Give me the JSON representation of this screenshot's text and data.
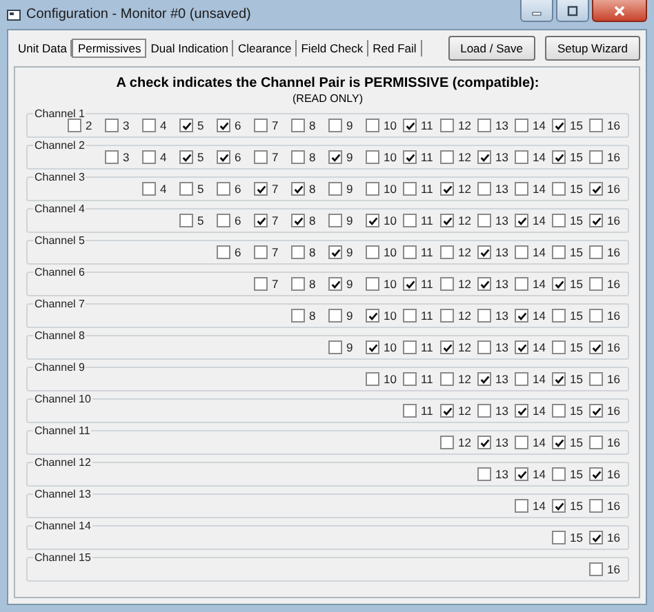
{
  "window": {
    "title": "Configuration - Monitor #0 (unsaved)"
  },
  "tabs": [
    {
      "label": "Unit Data",
      "selected": false
    },
    {
      "label": "Permissives",
      "selected": true
    },
    {
      "label": "Dual Indication",
      "selected": false
    },
    {
      "label": "Clearance",
      "selected": false
    },
    {
      "label": "Field Check",
      "selected": false
    },
    {
      "label": "Red Fail",
      "selected": false
    }
  ],
  "buttons": [
    "Load / Save",
    "Setup Wizard"
  ],
  "heading": "A check indicates the Channel Pair is PERMISSIVE (compatible):",
  "subheading": "(READ ONLY)",
  "channels": [
    {
      "name": "Channel 1",
      "pairs": [
        {
          "label": "2",
          "checked": false
        },
        {
          "label": "3",
          "checked": false
        },
        {
          "label": "4",
          "checked": false
        },
        {
          "label": "5",
          "checked": true
        },
        {
          "label": "6",
          "checked": true
        },
        {
          "label": "7",
          "checked": false
        },
        {
          "label": "8",
          "checked": false
        },
        {
          "label": "9",
          "checked": false
        },
        {
          "label": "10",
          "checked": false
        },
        {
          "label": "11",
          "checked": true
        },
        {
          "label": "12",
          "checked": false
        },
        {
          "label": "13",
          "checked": false
        },
        {
          "label": "14",
          "checked": false
        },
        {
          "label": "15",
          "checked": true
        },
        {
          "label": "16",
          "checked": false
        }
      ]
    },
    {
      "name": "Channel 2",
      "pairs": [
        {
          "label": "3",
          "checked": false
        },
        {
          "label": "4",
          "checked": false
        },
        {
          "label": "5",
          "checked": true
        },
        {
          "label": "6",
          "checked": true
        },
        {
          "label": "7",
          "checked": false
        },
        {
          "label": "8",
          "checked": false
        },
        {
          "label": "9",
          "checked": true
        },
        {
          "label": "10",
          "checked": false
        },
        {
          "label": "11",
          "checked": true
        },
        {
          "label": "12",
          "checked": false
        },
        {
          "label": "13",
          "checked": true
        },
        {
          "label": "14",
          "checked": false
        },
        {
          "label": "15",
          "checked": true
        },
        {
          "label": "16",
          "checked": false
        }
      ]
    },
    {
      "name": "Channel 3",
      "pairs": [
        {
          "label": "4",
          "checked": false
        },
        {
          "label": "5",
          "checked": false
        },
        {
          "label": "6",
          "checked": false
        },
        {
          "label": "7",
          "checked": true
        },
        {
          "label": "8",
          "checked": true
        },
        {
          "label": "9",
          "checked": false
        },
        {
          "label": "10",
          "checked": false
        },
        {
          "label": "11",
          "checked": false
        },
        {
          "label": "12",
          "checked": true
        },
        {
          "label": "13",
          "checked": false
        },
        {
          "label": "14",
          "checked": false
        },
        {
          "label": "15",
          "checked": false
        },
        {
          "label": "16",
          "checked": true
        }
      ]
    },
    {
      "name": "Channel 4",
      "pairs": [
        {
          "label": "5",
          "checked": false
        },
        {
          "label": "6",
          "checked": false
        },
        {
          "label": "7",
          "checked": true
        },
        {
          "label": "8",
          "checked": true
        },
        {
          "label": "9",
          "checked": false
        },
        {
          "label": "10",
          "checked": true
        },
        {
          "label": "11",
          "checked": false
        },
        {
          "label": "12",
          "checked": true
        },
        {
          "label": "13",
          "checked": false
        },
        {
          "label": "14",
          "checked": true
        },
        {
          "label": "15",
          "checked": false
        },
        {
          "label": "16",
          "checked": true
        }
      ]
    },
    {
      "name": "Channel 5",
      "pairs": [
        {
          "label": "6",
          "checked": false
        },
        {
          "label": "7",
          "checked": false
        },
        {
          "label": "8",
          "checked": false
        },
        {
          "label": "9",
          "checked": true
        },
        {
          "label": "10",
          "checked": false
        },
        {
          "label": "11",
          "checked": false
        },
        {
          "label": "12",
          "checked": false
        },
        {
          "label": "13",
          "checked": true
        },
        {
          "label": "14",
          "checked": false
        },
        {
          "label": "15",
          "checked": false
        },
        {
          "label": "16",
          "checked": false
        }
      ]
    },
    {
      "name": "Channel 6",
      "pairs": [
        {
          "label": "7",
          "checked": false
        },
        {
          "label": "8",
          "checked": false
        },
        {
          "label": "9",
          "checked": true
        },
        {
          "label": "10",
          "checked": false
        },
        {
          "label": "11",
          "checked": true
        },
        {
          "label": "12",
          "checked": false
        },
        {
          "label": "13",
          "checked": true
        },
        {
          "label": "14",
          "checked": false
        },
        {
          "label": "15",
          "checked": true
        },
        {
          "label": "16",
          "checked": false
        }
      ]
    },
    {
      "name": "Channel 7",
      "pairs": [
        {
          "label": "8",
          "checked": false
        },
        {
          "label": "9",
          "checked": false
        },
        {
          "label": "10",
          "checked": true
        },
        {
          "label": "11",
          "checked": false
        },
        {
          "label": "12",
          "checked": false
        },
        {
          "label": "13",
          "checked": false
        },
        {
          "label": "14",
          "checked": true
        },
        {
          "label": "15",
          "checked": false
        },
        {
          "label": "16",
          "checked": false
        }
      ]
    },
    {
      "name": "Channel 8",
      "pairs": [
        {
          "label": "9",
          "checked": false
        },
        {
          "label": "10",
          "checked": true
        },
        {
          "label": "11",
          "checked": false
        },
        {
          "label": "12",
          "checked": true
        },
        {
          "label": "13",
          "checked": false
        },
        {
          "label": "14",
          "checked": true
        },
        {
          "label": "15",
          "checked": false
        },
        {
          "label": "16",
          "checked": true
        }
      ]
    },
    {
      "name": "Channel 9",
      "pairs": [
        {
          "label": "10",
          "checked": false
        },
        {
          "label": "11",
          "checked": false
        },
        {
          "label": "12",
          "checked": false
        },
        {
          "label": "13",
          "checked": true
        },
        {
          "label": "14",
          "checked": false
        },
        {
          "label": "15",
          "checked": true
        },
        {
          "label": "16",
          "checked": false
        }
      ]
    },
    {
      "name": "Channel 10",
      "pairs": [
        {
          "label": "11",
          "checked": false
        },
        {
          "label": "12",
          "checked": true
        },
        {
          "label": "13",
          "checked": false
        },
        {
          "label": "14",
          "checked": true
        },
        {
          "label": "15",
          "checked": false
        },
        {
          "label": "16",
          "checked": true
        }
      ]
    },
    {
      "name": "Channel 11",
      "pairs": [
        {
          "label": "12",
          "checked": false
        },
        {
          "label": "13",
          "checked": true
        },
        {
          "label": "14",
          "checked": false
        },
        {
          "label": "15",
          "checked": true
        },
        {
          "label": "16",
          "checked": false
        }
      ]
    },
    {
      "name": "Channel 12",
      "pairs": [
        {
          "label": "13",
          "checked": false
        },
        {
          "label": "14",
          "checked": true
        },
        {
          "label": "15",
          "checked": false
        },
        {
          "label": "16",
          "checked": true
        }
      ]
    },
    {
      "name": "Channel 13",
      "pairs": [
        {
          "label": "14",
          "checked": false
        },
        {
          "label": "15",
          "checked": true
        },
        {
          "label": "16",
          "checked": false
        }
      ]
    },
    {
      "name": "Channel 14",
      "pairs": [
        {
          "label": "15",
          "checked": false
        },
        {
          "label": "16",
          "checked": true
        }
      ]
    },
    {
      "name": "Channel 15",
      "pairs": [
        {
          "label": "16",
          "checked": false
        }
      ]
    }
  ]
}
